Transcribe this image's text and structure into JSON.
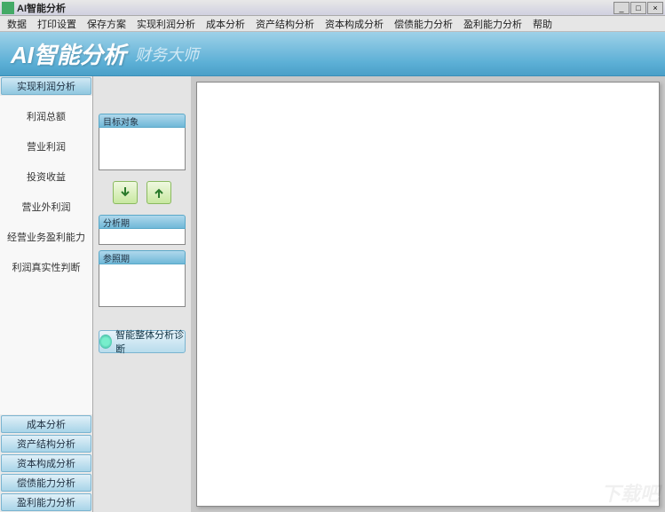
{
  "window": {
    "title": "AI智能分析"
  },
  "winbtns": {
    "min": "_",
    "max": "□",
    "close": "×"
  },
  "menu": [
    "数据",
    "打印设置",
    "保存方案",
    "实现利润分析",
    "成本分析",
    "资产结构分析",
    "资本构成分析",
    "偿债能力分析",
    "盈利能力分析",
    "帮助"
  ],
  "banner": {
    "big": "AI智能分析",
    "sub": "财务大师"
  },
  "sidebar": {
    "top_section": "实现利润分析",
    "items": [
      "利润总额",
      "营业利润",
      "投资收益",
      "营业外利润",
      "经营业务盈利能力",
      "利润真实性判断"
    ],
    "bottom_sections": [
      "成本分析",
      "资产结构分析",
      "资本构成分析",
      "偿债能力分析",
      "盈利能力分析"
    ]
  },
  "mid": {
    "panel1": "目标对象",
    "panel2": "分析期",
    "panel3": "参照期",
    "diag": "智能整体分析诊断"
  },
  "watermark": "下载吧"
}
